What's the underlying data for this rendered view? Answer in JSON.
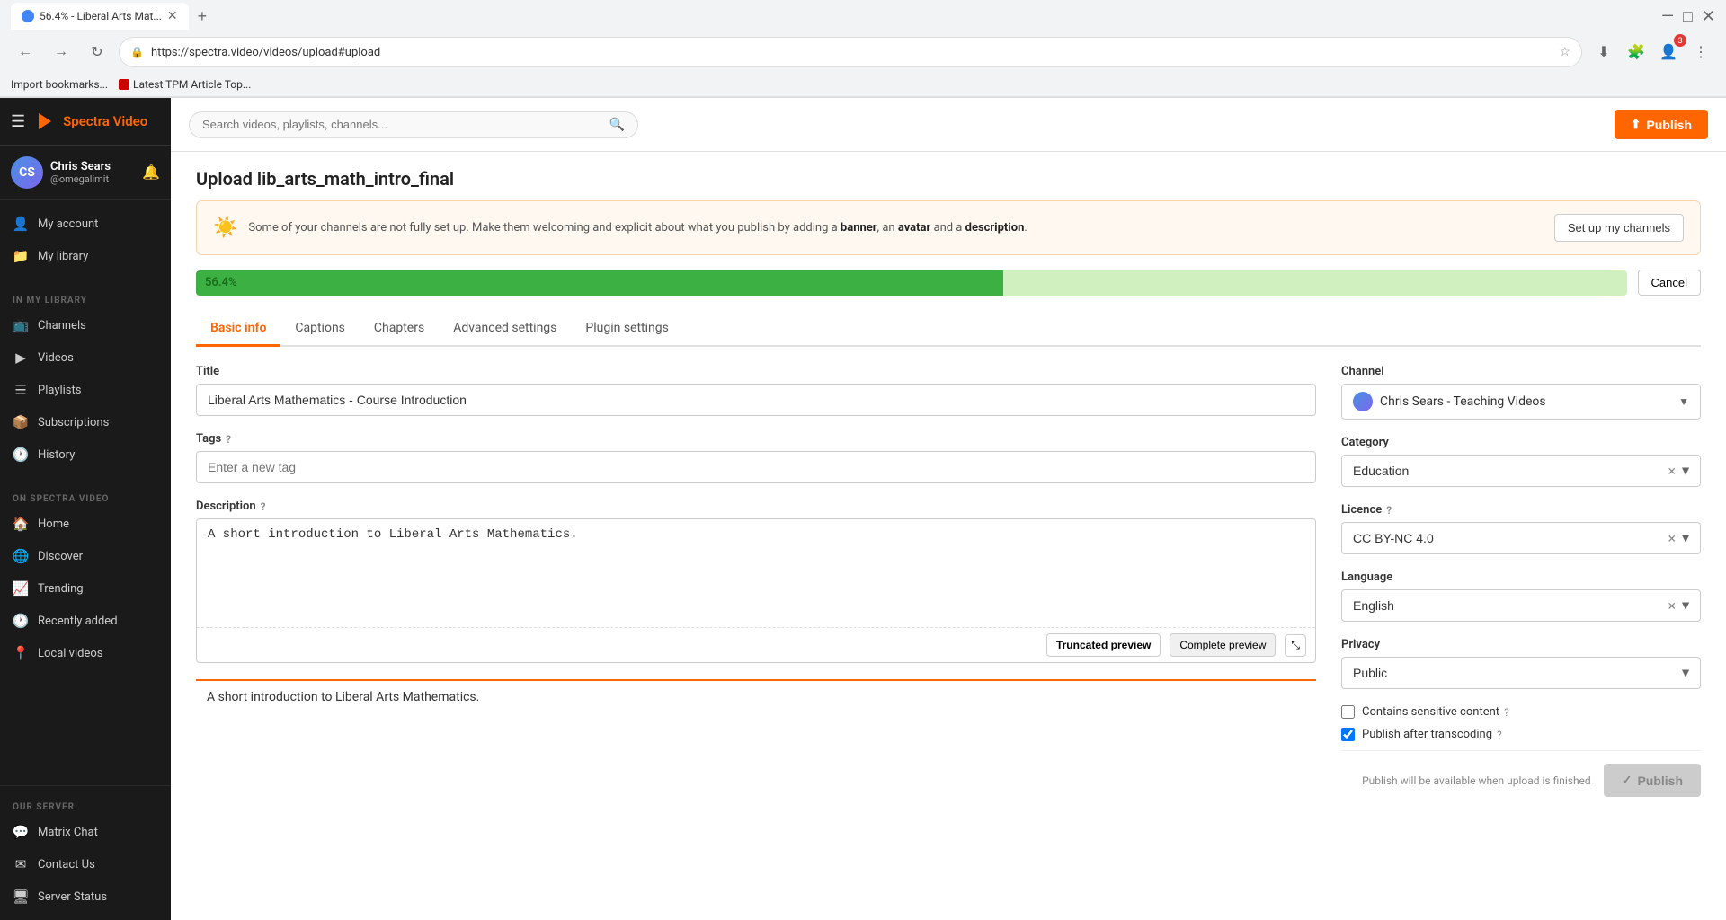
{
  "browser": {
    "tab_title": "56.4% - Liberal Arts Mat...",
    "tab_new_label": "+",
    "address": "https://spectra.video/videos/upload#upload",
    "bookmark1": "Import bookmarks...",
    "bookmark2": "Latest TPM Article Top..."
  },
  "topbar": {
    "logo_text": "Spectra Video",
    "search_placeholder": "Search videos, playlists, channels...",
    "publish_label": "Publish"
  },
  "sidebar": {
    "user_name": "Chris Sears",
    "user_handle": "@omegalimit",
    "user_avatar_initials": "CS",
    "my_account_label": "My account",
    "my_library_label": "My library",
    "in_my_library_section": "IN MY LIBRARY",
    "channels_label": "Channels",
    "videos_label": "Videos",
    "playlists_label": "Playlists",
    "subscriptions_label": "Subscriptions",
    "history_label": "History",
    "on_spectra_section": "ON SPECTRA VIDEO",
    "home_label": "Home",
    "discover_label": "Discover",
    "trending_label": "Trending",
    "recently_added_label": "Recently added",
    "local_videos_label": "Local videos",
    "our_server_section": "OUR SERVER",
    "matrix_chat_label": "Matrix Chat",
    "contact_us_label": "Contact Us",
    "server_status_label": "Server Status"
  },
  "page": {
    "title": "Upload lib_arts_math_intro_final",
    "notice_text": "Some of your channels are not fully set up. Make them welcoming and explicit about what you publish by adding a",
    "notice_bold1": "banner",
    "notice_mid1": ", an",
    "notice_bold2": "avatar",
    "notice_mid2": "and a",
    "notice_bold3": "description",
    "notice_end": ".",
    "setup_btn_label": "Set up my channels",
    "progress_percent": "56.4%",
    "cancel_btn_label": "Cancel"
  },
  "tabs": {
    "basic_info": "Basic info",
    "captions": "Captions",
    "chapters": "Chapters",
    "advanced_settings": "Advanced settings",
    "plugin_settings": "Plugin settings"
  },
  "form": {
    "title_label": "Title",
    "title_value": "Liberal Arts Mathematics - Course Introduction",
    "tags_label": "Tags",
    "tags_help": "?",
    "tags_placeholder": "Enter a new tag",
    "description_label": "Description",
    "description_help": "?",
    "description_value": "A short introduction to Liberal Arts Mathematics.",
    "truncated_preview_label": "Truncated preview",
    "complete_preview_label": "Complete preview",
    "expand_icon": "⤡",
    "preview_text": "A short introduction to Liberal Arts Mathematics."
  },
  "right_panel": {
    "channel_label": "Channel",
    "channel_name": "Chris Sears - Teaching Videos",
    "category_label": "Category",
    "category_value": "Education",
    "licence_label": "Licence",
    "licence_help": "?",
    "licence_value": "CC BY-NC 4.0",
    "language_label": "Language",
    "language_value": "English",
    "privacy_label": "Privacy",
    "privacy_value": "Public",
    "sensitive_label": "Contains sensitive content",
    "sensitive_help": "?",
    "sensitive_checked": false,
    "publish_after_label": "Publish after transcoding",
    "publish_after_help": "?",
    "publish_after_checked": true,
    "publish_note": "Publish will be available when upload is finished",
    "publish_btn_label": "Publish"
  },
  "icons": {
    "hamburger": "☰",
    "search": "🔍",
    "upload": "⬆",
    "bell": "🔔",
    "home": "🏠",
    "discover": "🌐",
    "trending": "📈",
    "recently_added": "🕐",
    "local_videos": "📍",
    "channels": "📺",
    "videos": "▶",
    "playlists": "☰",
    "subscriptions": "📦",
    "history": "🕐",
    "my_account": "👤",
    "my_library": "📁",
    "matrix": "💬",
    "contact": "✉",
    "server": "🖥",
    "notice_icon": "☀️",
    "lock": "🔒",
    "star": "☆",
    "back": "←",
    "forward": "→",
    "refresh": "↻",
    "upload_icon": "⬆",
    "check": "✓"
  }
}
